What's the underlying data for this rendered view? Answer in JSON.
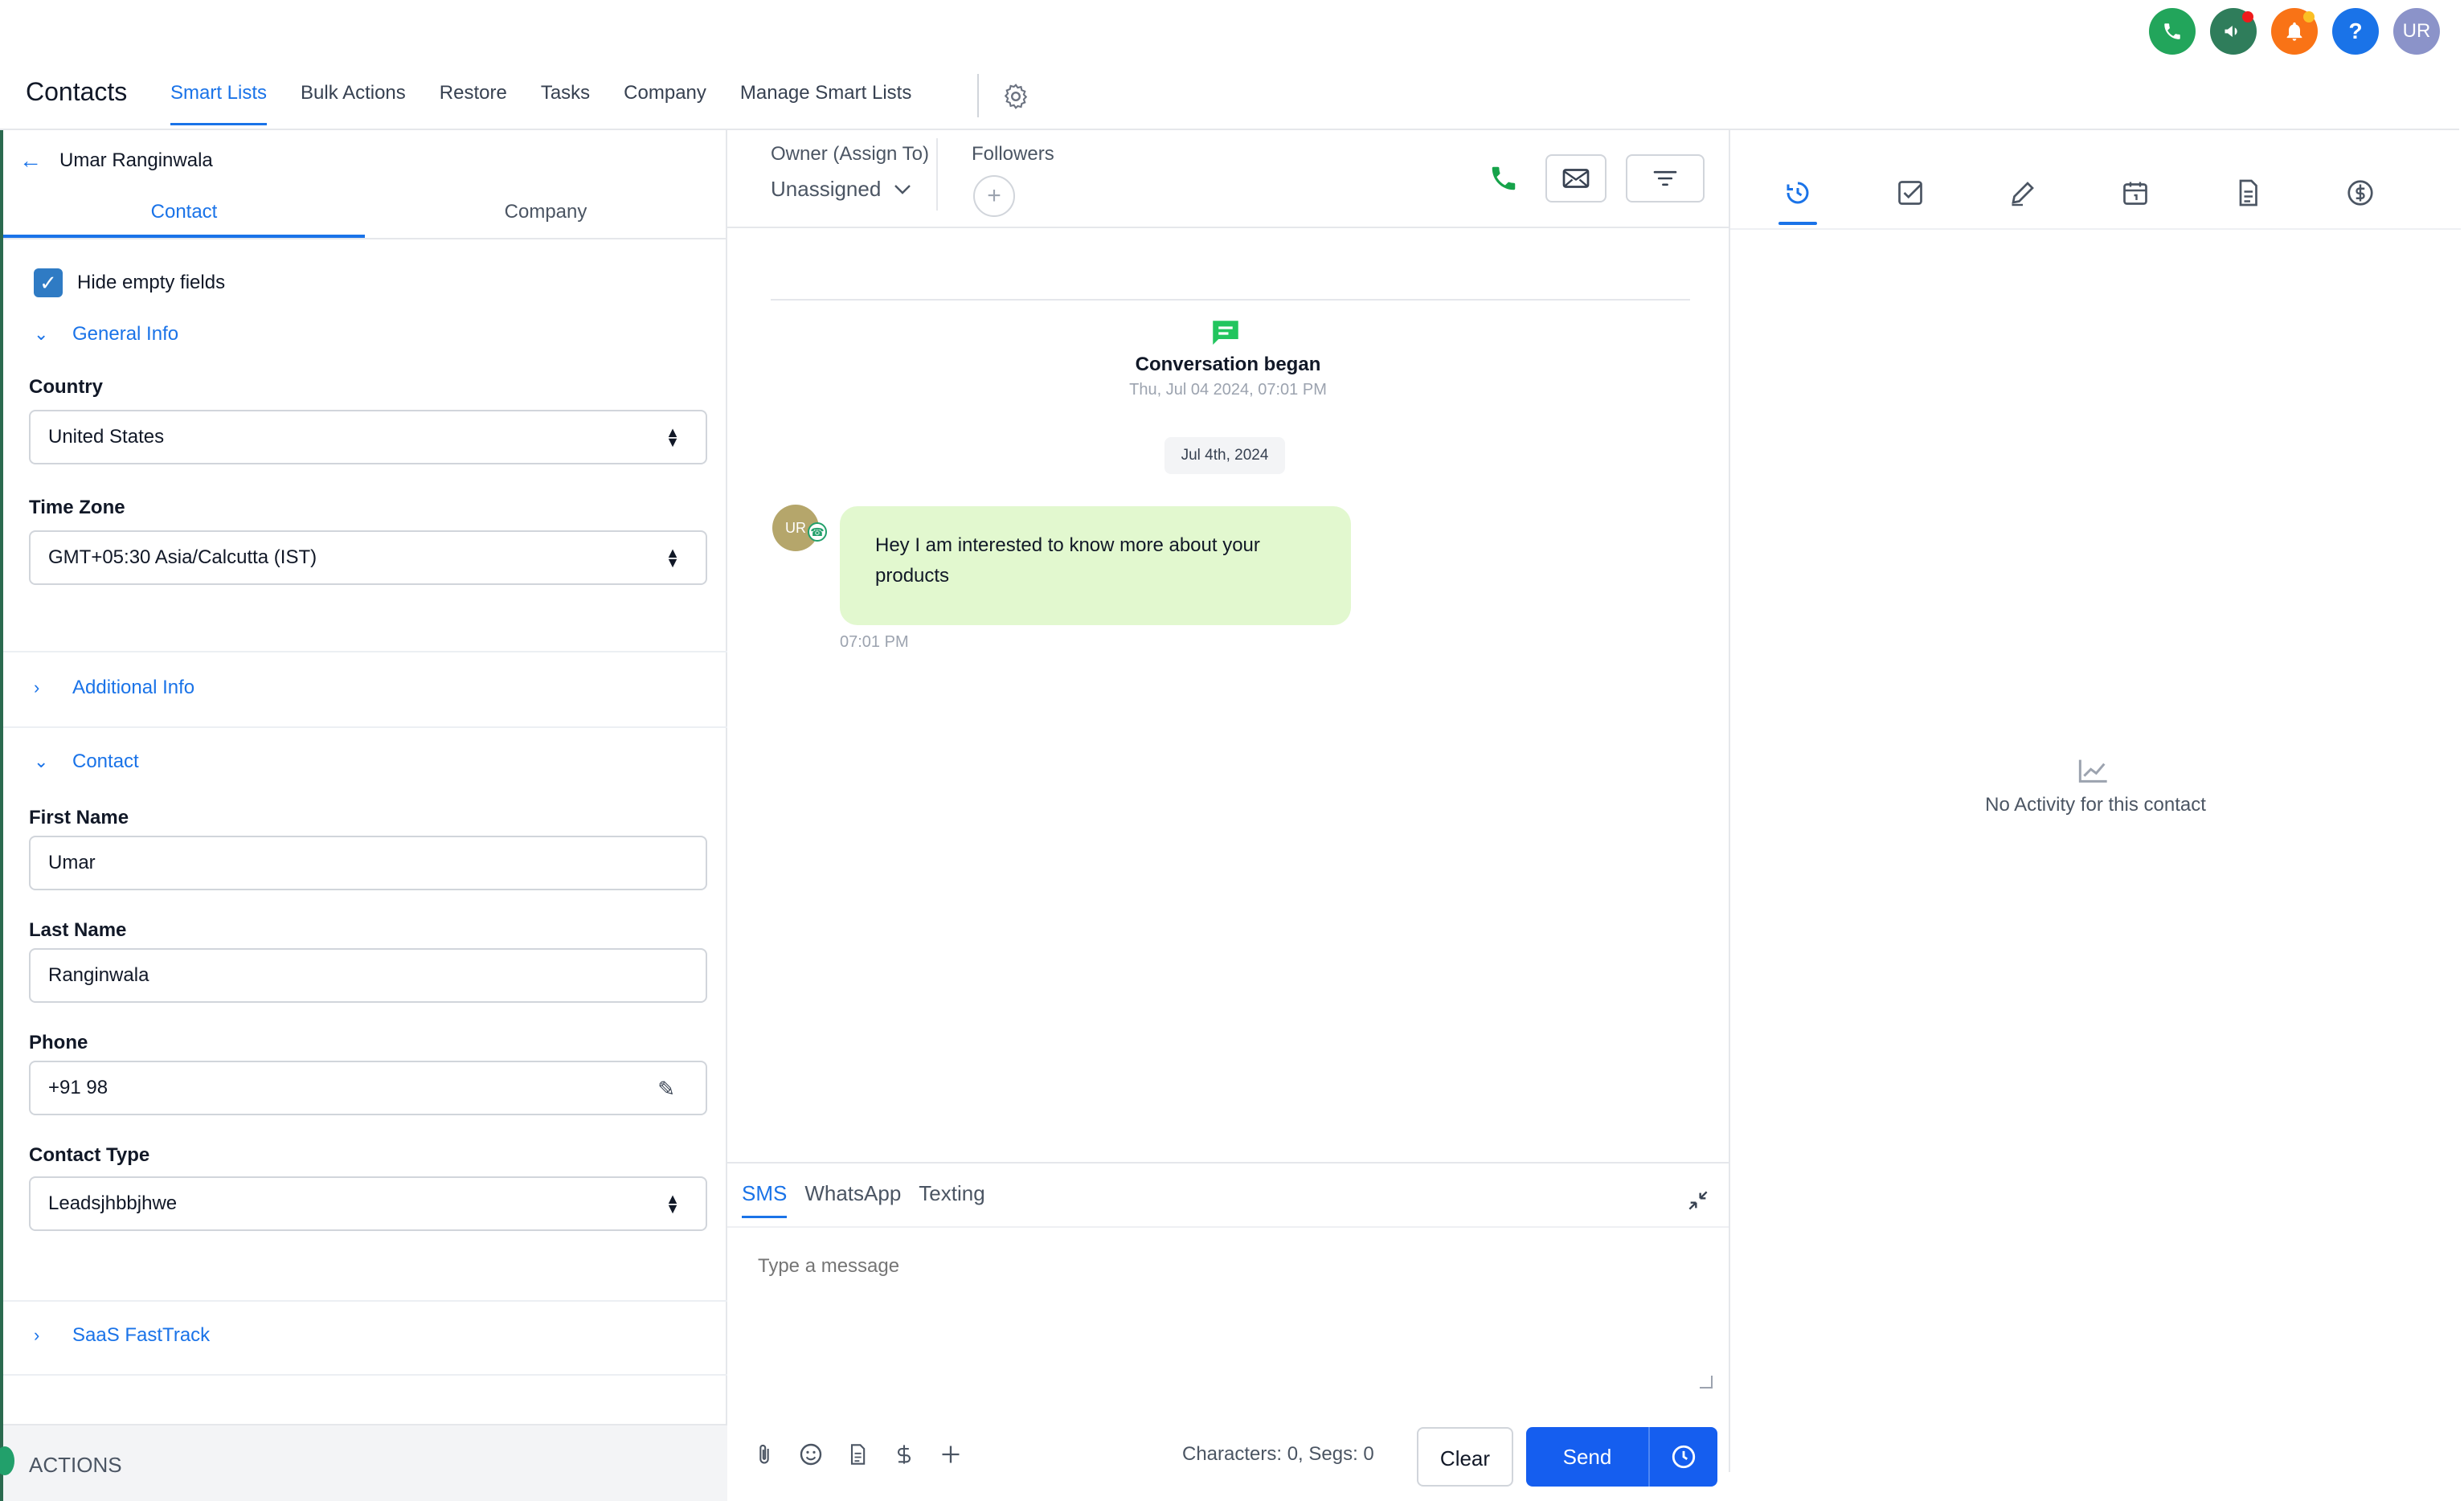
{
  "top_bar": {
    "avatar_initials": "UR",
    "help_glyph": "?",
    "icons": [
      {
        "name": "phone-icon",
        "color": "#22a55b"
      },
      {
        "name": "megaphone-icon",
        "color": "#2f7d5b"
      },
      {
        "name": "bell-icon",
        "color": "#f97316"
      },
      {
        "name": "help-icon",
        "color": "#1a73e8"
      },
      {
        "name": "avatar",
        "color": "#8b93c9"
      }
    ]
  },
  "header": {
    "title": "Contacts",
    "tabs": [
      {
        "label": "Smart Lists",
        "active": true
      },
      {
        "label": "Bulk Actions"
      },
      {
        "label": "Restore"
      },
      {
        "label": "Tasks"
      },
      {
        "label": "Company"
      },
      {
        "label": "Manage Smart Lists"
      }
    ]
  },
  "left_panel": {
    "contact_name": "Umar Ranginwala",
    "tabs": [
      {
        "label": "Contact",
        "active": true
      },
      {
        "label": "Company"
      }
    ],
    "hide_empty_label": "Hide empty fields",
    "hide_empty_checked": true,
    "sections": {
      "general": "General Info",
      "additional": "Additional Info",
      "contact": "Contact",
      "saas": "SaaS FastTrack"
    },
    "fields": {
      "country_label": "Country",
      "country_value": "United States",
      "timezone_label": "Time Zone",
      "timezone_value": "GMT+05:30 Asia/Calcutta (IST)",
      "first_name_label": "First Name",
      "first_name_value": "Umar",
      "last_name_label": "Last Name",
      "last_name_value": "Ranginwala",
      "phone_label": "Phone",
      "phone_value": "+91 98",
      "contact_type_label": "Contact Type",
      "contact_type_value": "Leadsjhbbjhwe"
    },
    "actions_label": "ACTIONS"
  },
  "conversation": {
    "owner_label": "Owner (Assign To)",
    "owner_value": "Unassigned",
    "followers_label": "Followers",
    "began_title": "Conversation began",
    "began_date": "Thu, Jul 04 2024, 07:01 PM",
    "date_chip": "Jul 4th, 2024",
    "message": {
      "avatar": "UR",
      "text": "Hey I am interested to know more about your products",
      "time": "07:01 PM"
    },
    "composer": {
      "channels": [
        {
          "label": "SMS",
          "active": true
        },
        {
          "label": "WhatsApp"
        },
        {
          "label": "Texting"
        }
      ],
      "placeholder": "Type a message",
      "counter": "Characters: 0, Segs: 0",
      "clear_label": "Clear",
      "send_label": "Send"
    }
  },
  "activity": {
    "tabs": [
      "history-icon",
      "task-icon",
      "note-icon",
      "calendar-icon",
      "document-icon",
      "payment-icon"
    ],
    "empty_text": "No Activity for this contact"
  },
  "colors": {
    "accent": "#1a73e8",
    "send": "#155eef",
    "bubble": "#e2f8cf",
    "whatsapp_green": "#22a06b"
  }
}
